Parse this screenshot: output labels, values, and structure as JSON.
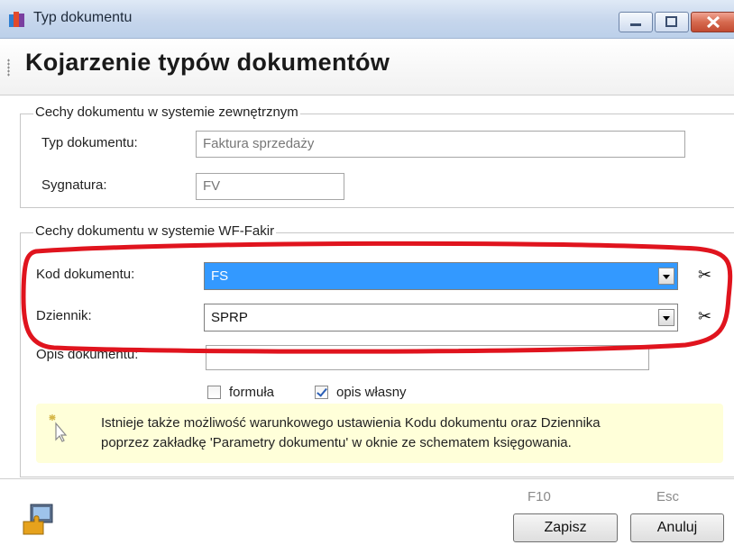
{
  "window": {
    "title": "Typ dokumentu",
    "icon": "book-stack-icon",
    "controls": [
      "minimize-icon",
      "maximize-icon",
      "close-icon"
    ]
  },
  "header": {
    "title": "Kojarzenie typów dokumentów"
  },
  "external_group": {
    "legend": "Cechy dokumentu w systemie zewnętrznym",
    "doc_type_label": "Typ dokumentu:",
    "doc_type_value": "Faktura sprzedaży",
    "signature_label": "Sygnatura:",
    "signature_value": "FV"
  },
  "wf_group": {
    "legend": "Cechy dokumentu w systemie WF-Fakir",
    "code_label": "Kod dokumentu:",
    "code_value": "FS",
    "journal_label": "Dziennik:",
    "journal_value": "SPRP",
    "description_label": "Opis dokumentu:",
    "description_value": "",
    "formula_label": "formuła",
    "formula_checked": false,
    "own_desc_label": "opis własny",
    "own_desc_checked": true,
    "clear_icon": "scissors-icon"
  },
  "info": {
    "icon": "sparkle-cursor-icon",
    "line1": "Istnieje także możliwość warunkowego ustawienia Kodu dokumentu oraz Dziennika",
    "line2": "poprzez zakładkę 'Parametry dokumentu' w oknie ze schematem księgowania."
  },
  "footer": {
    "app_icon": "puzzle-computer-icon",
    "save_key": "F10",
    "save_label": "Zapisz",
    "cancel_key": "Esc",
    "cancel_label": "Anuluj"
  },
  "colors": {
    "selection": "#3399ff",
    "annotation_ring": "#e0141e",
    "info_background": "#ffffd9"
  }
}
